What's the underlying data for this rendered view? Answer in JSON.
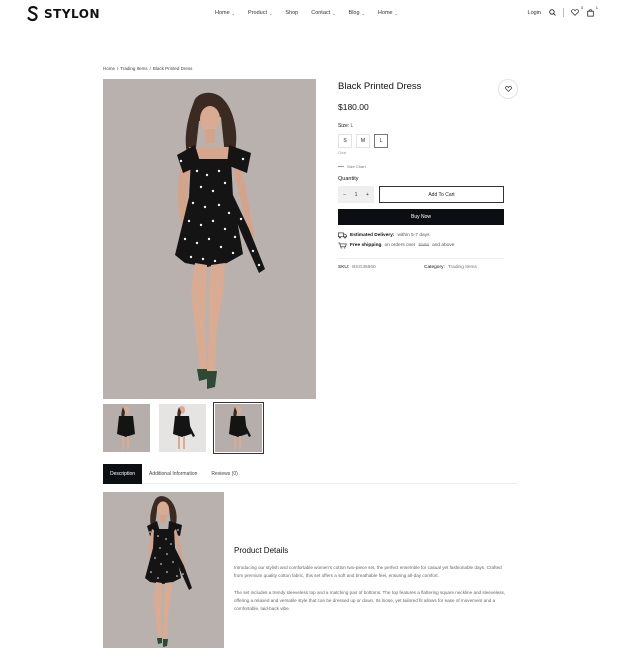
{
  "header": {
    "logo_text": "STYLON",
    "nav": [
      {
        "label": "Home",
        "has_dropdown": true
      },
      {
        "label": "Product",
        "has_dropdown": true
      },
      {
        "label": "Shop",
        "has_dropdown": false
      },
      {
        "label": "Contact",
        "has_dropdown": true
      },
      {
        "label": "Blog",
        "has_dropdown": true
      },
      {
        "label": "Home",
        "has_dropdown": true
      }
    ],
    "login_label": "Login",
    "wishlist_count": "3",
    "cart_count": "1"
  },
  "breadcrumb": {
    "home": "Home",
    "sep1": "/",
    "category": "Trading Items",
    "sep2": "/",
    "current": "Black Printed Dress"
  },
  "product": {
    "title": "Black Printed Dress",
    "price": "$180.00",
    "size_label": "Size:",
    "size_selected": "L",
    "sizes": [
      "S",
      "M",
      "L"
    ],
    "clear_label": "Clear",
    "size_chart_label": "Size Chart",
    "quantity_label": "Quantity",
    "quantity_value": "1",
    "minus_label": "−",
    "plus_label": "+",
    "add_to_cart_label": "Add To Cart",
    "buy_now_label": "Buy Now",
    "delivery_label": "Estimated Delivery:",
    "delivery_value": "within 5-7 days",
    "shipping_label": "Free shipping",
    "shipping_text_1": "on orders over",
    "shipping_amount": "$999",
    "shipping_text_2": "and above",
    "sku_label": "SKU:",
    "sku_value": "BSG35660",
    "category_label": "Category:",
    "category_value": "Trading Items"
  },
  "tabs": [
    {
      "label": "Description",
      "active": true
    },
    {
      "label": "Additional Information",
      "active": false
    },
    {
      "label": "Reviews (0)",
      "active": false
    }
  ],
  "description": {
    "title": "Product Details",
    "paragraph_1": "Introducing our stylish and comfortable women's cotton two-piece set, the perfect ensemble for casual yet fashionable days. Crafted from premium quality cotton fabric, this set offers a soft and breathable feel, ensuring all-day comfort.",
    "paragraph_2": "The set includes a trendy sleeveless top and a matching pair of bottoms. The top features a flattering square neckline and sleeveless, offering a relaxed and versatile style that can be dressed up or down. Its loose, yet tailored fit allows for ease of movement and a comfortable, laid-back vibe."
  },
  "colors": {
    "image_bg": "#b8b1ae",
    "dark_button": "#0b0f14",
    "dress": "#141414"
  }
}
